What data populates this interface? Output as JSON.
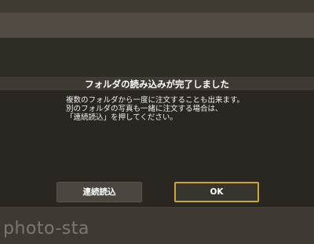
{
  "dialog": {
    "title": "フォルダの読み込みが完了しました",
    "message_lines": [
      "複数のフォルダから一度に注文することも出来ます。",
      "別のフォルダの写真も一緒に注文する場合は、",
      "「連続読込」を押してください。"
    ],
    "buttons": {
      "continuous_label": "連続読込",
      "ok_label": "OK"
    }
  },
  "watermark": {
    "text": "photo-sta"
  },
  "colors": {
    "dialog_background": "#2a2621",
    "screen_background": "#3e3a33",
    "ok_border_accent": "#c8a63a",
    "text": "#ffffff"
  }
}
